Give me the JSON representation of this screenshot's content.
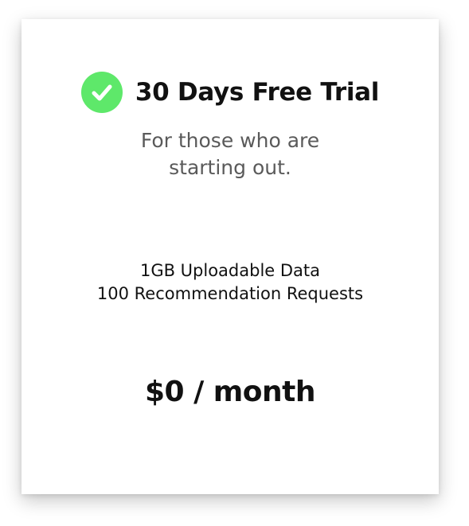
{
  "plan": {
    "title": "30 Days Free Trial",
    "subtitle_line1": "For those who are",
    "subtitle_line2": "starting out.",
    "features": [
      "1GB Uploadable Data",
      "100 Recommendation Requests"
    ],
    "price": "$0 / month",
    "icon": "check-circle-icon",
    "accent_color": "#5ee86a"
  }
}
